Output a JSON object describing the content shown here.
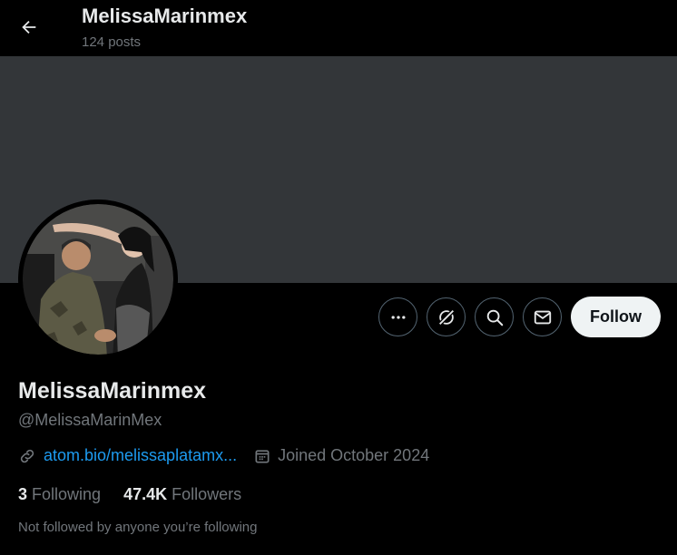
{
  "header": {
    "title": "MelissaMarinmex",
    "posts_count": "124 posts"
  },
  "profile": {
    "display_name": "MelissaMarinmex",
    "handle": "@MelissaMarinMex",
    "link": "atom.bio/melissaplatamx...",
    "joined": "Joined October 2024",
    "following_count": "3",
    "following_label": "Following",
    "followers_count": "47.4K",
    "followers_label": "Followers",
    "not_followed_note": "Not followed by anyone you’re following"
  },
  "actions": {
    "follow_label": "Follow",
    "more_icon": "more-icon",
    "grok_icon": "grok-icon",
    "search_icon": "search-icon",
    "message_icon": "envelope-icon"
  },
  "colors": {
    "background": "#000000",
    "banner": "#333639",
    "link": "#1d9bf0",
    "secondary_text": "#71767b",
    "primary_text": "#e7e9ea",
    "follow_button_bg": "#eff3f4"
  }
}
